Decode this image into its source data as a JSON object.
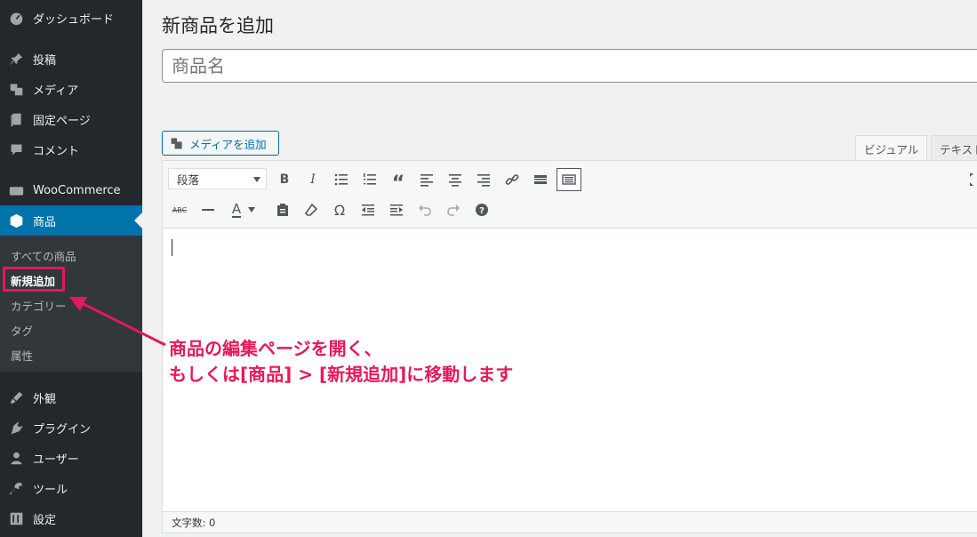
{
  "sidebar": {
    "items": [
      {
        "label": "ダッシュボード",
        "icon": "dashboard-icon"
      },
      {
        "label": "投稿",
        "icon": "pin-icon"
      },
      {
        "label": "メディア",
        "icon": "media-icon"
      },
      {
        "label": "固定ページ",
        "icon": "page-icon"
      },
      {
        "label": "コメント",
        "icon": "comment-icon"
      },
      {
        "label": "WooCommerce",
        "icon": "woo-icon"
      },
      {
        "label": "商品",
        "icon": "product-box-icon"
      },
      {
        "label": "外観",
        "icon": "brush-icon"
      },
      {
        "label": "プラグイン",
        "icon": "plugin-icon"
      },
      {
        "label": "ユーザー",
        "icon": "user-icon"
      },
      {
        "label": "ツール",
        "icon": "wrench-icon"
      },
      {
        "label": "設定",
        "icon": "settings-icon"
      }
    ],
    "submenu": [
      "すべての商品",
      "新規追加",
      "カテゴリー",
      "タグ",
      "属性"
    ]
  },
  "main": {
    "page_title": "新商品を追加",
    "title_placeholder": "商品名",
    "add_media_label": "メディアを追加",
    "tabs": {
      "visual": "ビジュアル",
      "text": "テキスト"
    },
    "format_select_value": "段落",
    "word_count": "文字数: 0"
  },
  "annotation": {
    "line1": "商品の編集ページを開く、",
    "line2": "もしくは[商品] > [新規追加]に移動します"
  },
  "colors": {
    "sidebar_bg": "#23282d",
    "submenu_bg": "#32373c",
    "active": "#0073aa",
    "annotation": "#e6195a"
  }
}
